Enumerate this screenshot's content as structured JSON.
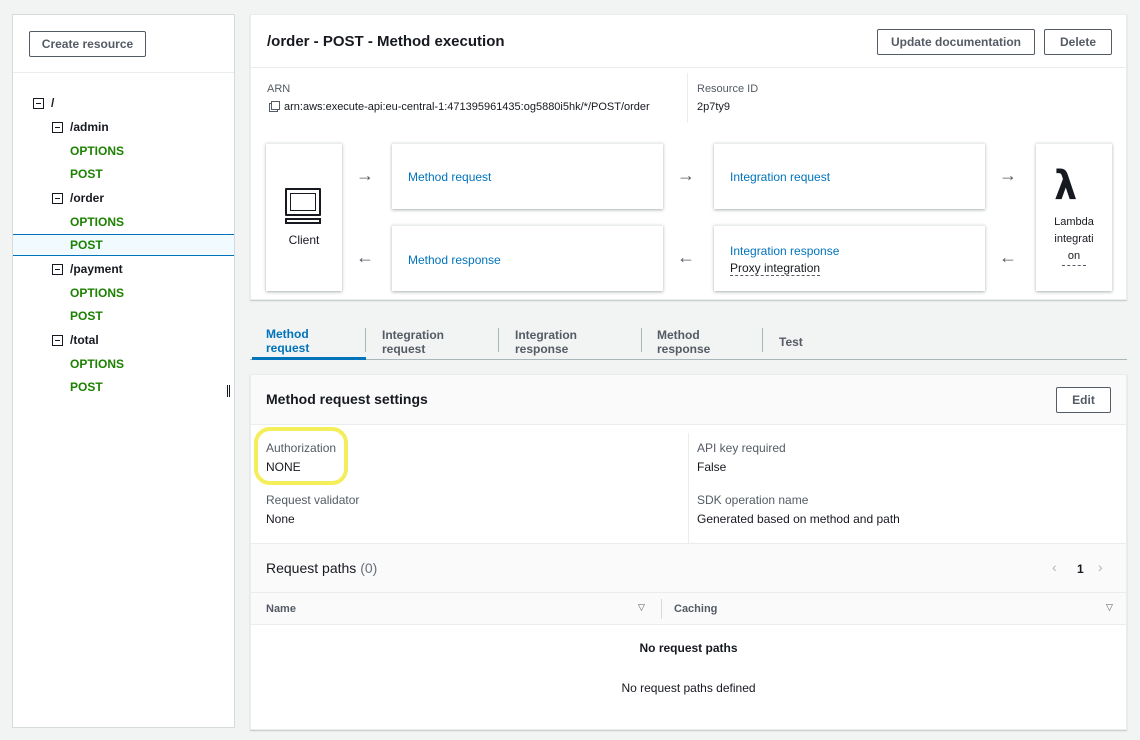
{
  "sidebar": {
    "create_resource_label": "Create resource",
    "tree": [
      {
        "kind": "resource",
        "label": "/",
        "indent": 0
      },
      {
        "kind": "resource",
        "label": "/admin",
        "indent": 1
      },
      {
        "kind": "method",
        "label": "OPTIONS"
      },
      {
        "kind": "method",
        "label": "POST"
      },
      {
        "kind": "resource",
        "label": "/order",
        "indent": 1
      },
      {
        "kind": "method",
        "label": "OPTIONS"
      },
      {
        "kind": "method",
        "label": "POST",
        "selected": true
      },
      {
        "kind": "resource",
        "label": "/payment",
        "indent": 1
      },
      {
        "kind": "method",
        "label": "OPTIONS"
      },
      {
        "kind": "method",
        "label": "POST"
      },
      {
        "kind": "resource",
        "label": "/total",
        "indent": 1
      },
      {
        "kind": "method",
        "label": "OPTIONS"
      },
      {
        "kind": "method",
        "label": "POST"
      }
    ]
  },
  "header": {
    "title": "/order - POST - Method execution",
    "update_documentation_label": "Update documentation",
    "delete_label": "Delete"
  },
  "details": {
    "arn_label": "ARN",
    "arn_value": "arn:aws:execute-api:eu-central-1:471395961435:og5880i5hk/*/POST/order",
    "resource_id_label": "Resource ID",
    "resource_id_value": "2p7ty9"
  },
  "flow": {
    "client_label": "Client",
    "method_request": "Method request",
    "integration_request": "Integration request",
    "method_response": "Method response",
    "integration_response": "Integration response",
    "integration_response_sub": "Proxy integration",
    "lambda_line1": "Lambda",
    "lambda_line2": "integrati",
    "lambda_line3": "on",
    "arrow_right": "→",
    "arrow_left": "←"
  },
  "tabs": [
    {
      "label": "Method request",
      "active": true
    },
    {
      "label": "Integration request"
    },
    {
      "label": "Integration response"
    },
    {
      "label": "Method response"
    },
    {
      "label": "Test"
    }
  ],
  "settings": {
    "title": "Method request settings",
    "edit_label": "Edit",
    "authorization_label": "Authorization",
    "authorization_value": "NONE",
    "api_key_label": "API key required",
    "api_key_value": "False",
    "request_validator_label": "Request validator",
    "request_validator_value": "None",
    "sdk_operation_label": "SDK operation name",
    "sdk_operation_value": "Generated based on method and path"
  },
  "request_paths": {
    "title": "Request paths",
    "count": "(0)",
    "page": "1",
    "prev_icon": "‹",
    "next_icon": "›",
    "columns": [
      "Name",
      "Caching"
    ],
    "sort_icon": "▽",
    "empty_title": "No request paths",
    "empty_text": "No request paths defined"
  },
  "colors": {
    "accent": "#0073bb",
    "method_green": "#1d8102",
    "highlight": "#f4ee5a"
  }
}
